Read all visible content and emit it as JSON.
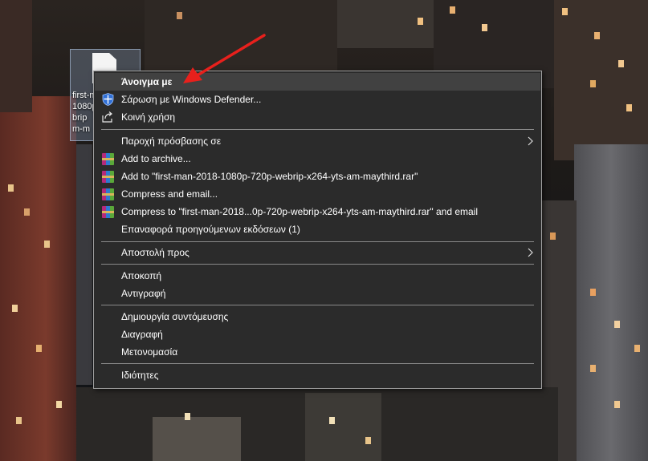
{
  "desktop": {
    "file_icon_caption": "first-m\n1080p\nbrip\nm-m"
  },
  "context_menu": {
    "items": [
      {
        "label": "Άνοιγμα με",
        "icon": "none",
        "bold": true,
        "hover": true
      },
      {
        "label": "Σάρωση με Windows Defender...",
        "icon": "shield-icon"
      },
      {
        "label": "Κοινή χρήση",
        "icon": "share-icon"
      },
      {
        "label": "Παροχή πρόσβασης σε",
        "icon": "none",
        "submenu": true
      },
      {
        "label": "Add to archive...",
        "icon": "winrar-icon"
      },
      {
        "label": "Add to \"first-man-2018-1080p-720p-webrip-x264-yts-am-maythird.rar\"",
        "icon": "winrar-icon"
      },
      {
        "label": "Compress and email...",
        "icon": "winrar-icon"
      },
      {
        "label": "Compress to \"first-man-2018...0p-720p-webrip-x264-yts-am-maythird.rar\" and email",
        "icon": "winrar-icon"
      },
      {
        "label": "Επαναφορά προηγούμενων εκδόσεων (1)",
        "icon": "none"
      },
      {
        "label": "Αποστολή προς",
        "icon": "none",
        "submenu": true
      },
      {
        "label": "Αποκοπή",
        "icon": "none"
      },
      {
        "label": "Αντιγραφή",
        "icon": "none"
      },
      {
        "label": "Δημιουργία συντόμευσης",
        "icon": "none"
      },
      {
        "label": "Διαγραφή",
        "icon": "none"
      },
      {
        "label": "Μετονομασία",
        "icon": "none"
      },
      {
        "label": "Ιδιότητες",
        "icon": "none"
      }
    ]
  },
  "colors": {
    "menu_bg": "#2b2b2b",
    "menu_hover": "#414141",
    "menu_border": "#a0a0a0",
    "annotation_arrow": "#e8201c"
  }
}
